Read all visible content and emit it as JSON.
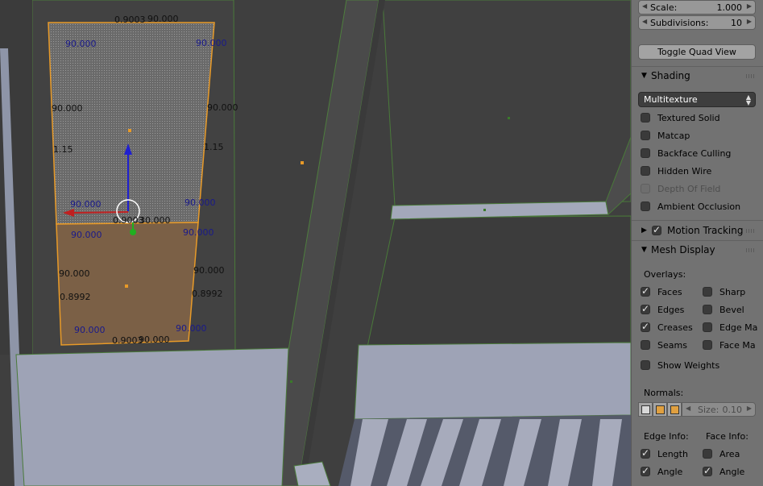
{
  "viewport": {
    "labels": [
      {
        "text": "0.9003",
        "color": "k"
      },
      {
        "text": "90.000",
        "color": "k"
      },
      {
        "text": "90.000",
        "color": "b"
      },
      {
        "text": "90.000",
        "color": "b"
      },
      {
        "text": "90.000",
        "color": "k"
      },
      {
        "text": "90.000",
        "color": "k"
      },
      {
        "text": "1.15",
        "color": "k"
      },
      {
        "text": "1.15",
        "color": "k"
      },
      {
        "text": "90.000",
        "color": "b"
      },
      {
        "text": "90.000",
        "color": "b"
      },
      {
        "text": "0.9003",
        "color": "k"
      },
      {
        "text": "30.000",
        "color": "k"
      },
      {
        "text": "90.000",
        "color": "b"
      },
      {
        "text": "90.000",
        "color": "b"
      },
      {
        "text": "90.000",
        "color": "k"
      },
      {
        "text": "90.000",
        "color": "k"
      },
      {
        "text": "0.8992",
        "color": "k"
      },
      {
        "text": "0.8992",
        "color": "k"
      },
      {
        "text": "90.000",
        "color": "b"
      },
      {
        "text": "90.000",
        "color": "b"
      },
      {
        "text": "0.9003",
        "color": "k"
      },
      {
        "text": "90.000",
        "color": "k"
      }
    ]
  },
  "panel": {
    "scale": {
      "label": "Scale:",
      "value": "1.000"
    },
    "subdivisions": {
      "label": "Subdivisions:",
      "value": "10"
    },
    "toggle_quad_view": "Toggle Quad View",
    "shading": {
      "title": "Shading",
      "mode": "Multitexture",
      "options": [
        {
          "label": "Textured Solid",
          "checked": false,
          "disabled": false
        },
        {
          "label": "Matcap",
          "checked": false,
          "disabled": false
        },
        {
          "label": "Backface Culling",
          "checked": false,
          "disabled": false
        },
        {
          "label": "Hidden Wire",
          "checked": false,
          "disabled": false
        },
        {
          "label": "Depth Of Field",
          "checked": false,
          "disabled": true
        },
        {
          "label": "Ambient Occlusion",
          "checked": false,
          "disabled": false
        }
      ]
    },
    "motion_tracking": {
      "title": "Motion Tracking",
      "checked": true
    },
    "mesh_display": {
      "title": "Mesh Display",
      "overlays_label": "Overlays:",
      "overlays_left": [
        {
          "label": "Faces",
          "checked": true
        },
        {
          "label": "Edges",
          "checked": true
        },
        {
          "label": "Creases",
          "checked": true
        },
        {
          "label": "Seams",
          "checked": false
        }
      ],
      "overlays_right": [
        {
          "label": "Sharp",
          "checked": false
        },
        {
          "label": "Bevel",
          "checked": false
        },
        {
          "label": "Edge Ma",
          "checked": false
        },
        {
          "label": "Face Ma",
          "checked": false
        }
      ],
      "show_weights": {
        "label": "Show Weights",
        "checked": false
      },
      "normals_label": "Normals:",
      "normals_size": {
        "label": "Size:",
        "value": "0.10"
      },
      "edge_info_label": "Edge Info:",
      "face_info_label": "Face Info:",
      "edge_info": [
        {
          "label": "Length",
          "checked": true
        },
        {
          "label": "Angle",
          "checked": true
        }
      ],
      "face_info": [
        {
          "label": "Area",
          "checked": false
        },
        {
          "label": "Angle",
          "checked": true
        }
      ]
    }
  }
}
